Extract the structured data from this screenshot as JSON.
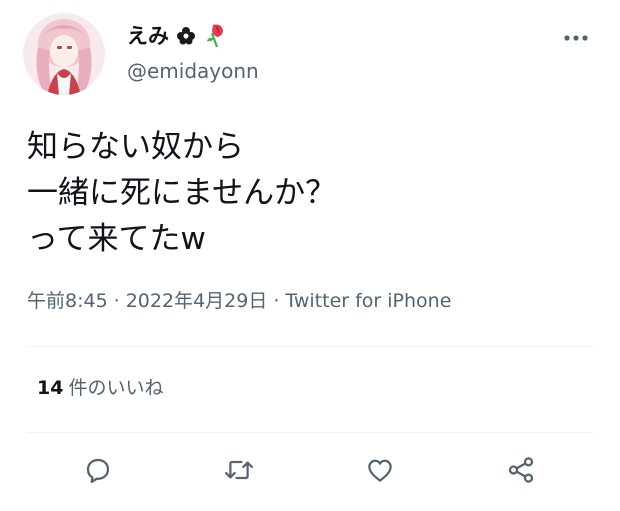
{
  "author": {
    "display_name": "えみ",
    "handle": "@emidayonn",
    "name_emoji_icons": [
      "flower-emoji-icon",
      "wilted-rose-emoji-icon"
    ]
  },
  "tweet": {
    "lines": [
      "知らない奴から",
      "一緒に死にませんか？",
      "って来てたw"
    ],
    "time": "午前8:45",
    "separator": "·",
    "date": "2022年4月29日",
    "source": "Twitter for iPhone"
  },
  "stats": {
    "likes_count": "14",
    "likes_label": "件のいいね"
  },
  "actions": [
    "reply-icon",
    "retweet-icon",
    "like-icon",
    "share-icon"
  ],
  "colors": {
    "text_primary": "#0f1419",
    "text_secondary": "#536471",
    "divider": "#eff3f4",
    "icon": "#536471"
  }
}
